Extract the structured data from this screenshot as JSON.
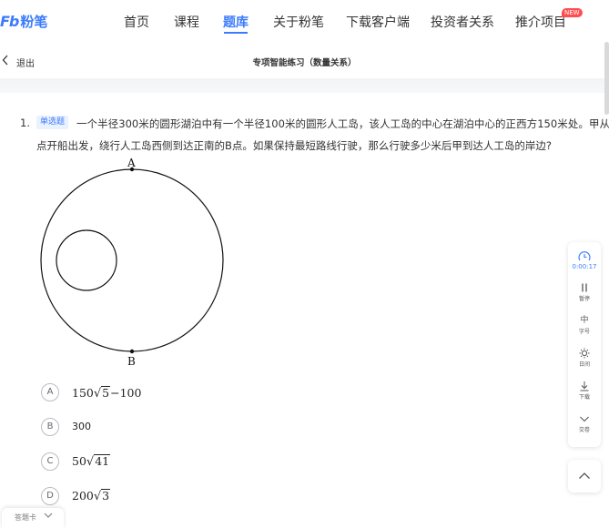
{
  "nav": {
    "logo_mark": "Fb",
    "logo_text": "粉笔",
    "items": [
      "首页",
      "课程",
      "题库",
      "关于粉笔",
      "下载客户端",
      "投资者关系",
      "推介项目"
    ],
    "active_index": 2,
    "badge": "NEW",
    "accent_color": "#3c7cfc",
    "badge_color": "#ff4d4f"
  },
  "subheader": {
    "exit_label": "退出",
    "page_title": "专项智能练习（数量关系）",
    "back_icon": "chevron-left-icon"
  },
  "question": {
    "number": "1.",
    "type": "单选题",
    "stem_line1": "一个半径300米的圆形湖泊中有一个半径100米的圆形人工岛，该人工岛的中心在湖泊中心的正西方150米处。甲从湖泊",
    "stem_line2": "点开船出发，绕行人工岛西侧到达正南的B点。如果保持最短路线行驶，那么行驶多少米后甲到达人工岛的岸边?"
  },
  "diagram": {
    "label_top": "A",
    "label_bottom": "B"
  },
  "options": [
    {
      "letter": "A",
      "coef": "150",
      "radicand": "5",
      "suffix": "−100"
    },
    {
      "letter": "B",
      "text": "300"
    },
    {
      "letter": "C",
      "coef": "50",
      "radicand": "41",
      "suffix": ""
    },
    {
      "letter": "D",
      "coef": "200",
      "radicand": "3",
      "suffix": ""
    }
  ],
  "toolbar": {
    "timer": "0:00:17",
    "pause": "暂停",
    "font_size": "字号",
    "font_glyph": "中",
    "daylight": "日间",
    "download": "下载",
    "submit": "交卷"
  },
  "answer_card": {
    "label": "答题卡"
  }
}
